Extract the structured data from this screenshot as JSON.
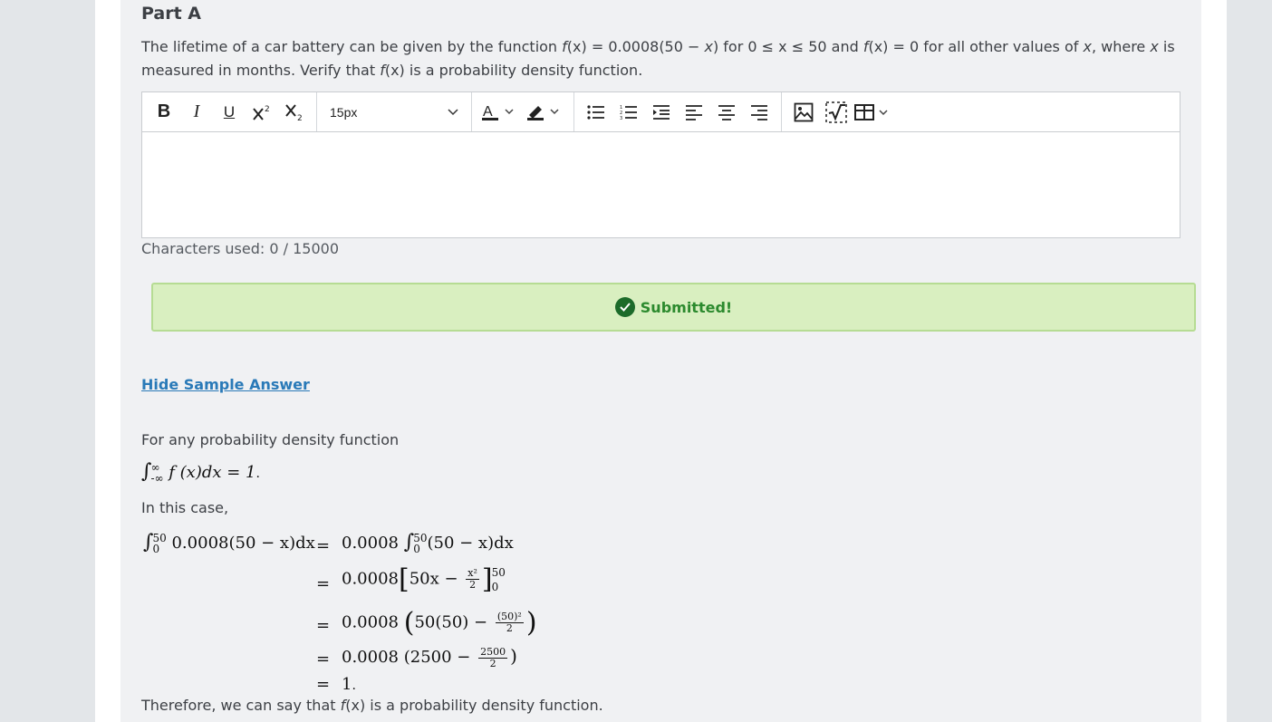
{
  "part_title": "Part A",
  "prompt": {
    "t1": "The lifetime of a car battery can be given by the function ",
    "f": "f",
    "x1": "(x)",
    "t2": " = 0.0008(50 − ",
    "x2": "x",
    "t3": ") for 0 ≤ x ≤ 50 and ",
    "f2": "f",
    "x3": "(x)",
    "t4": " = 0 for all other values of ",
    "x4": "x",
    "t5": ", where ",
    "x5": "x",
    "t6": " is measured in months. Verify that ",
    "f3": "f",
    "x6": "(x)",
    "t7": " is a probability density function."
  },
  "toolbar": {
    "bold": "B",
    "italic": "I",
    "underline": "U",
    "superscript_icon": "superscript-icon",
    "subscript_icon": "subscript-icon",
    "font_size": "15px",
    "font_color_icon": "font-color-icon",
    "highlight_icon": "highlight-icon",
    "bullet_list_icon": "bullet-list-icon",
    "numbered_list_icon": "numbered-list-icon",
    "indent_icon": "indent-icon",
    "align_left_icon": "align-left-icon",
    "align_center_icon": "align-center-icon",
    "align_right_icon": "align-right-icon",
    "image_icon": "image-icon",
    "equation_icon": "equation-icon",
    "table_icon": "table-icon"
  },
  "char_count": "Characters used: 0 / 15000",
  "status": {
    "label": "Submitted!",
    "color": "#2c8a2e",
    "bg": "#d9efc0"
  },
  "hide_link": "Hide Sample Answer",
  "answer": {
    "line1": "For any probability density function",
    "line2": "In this case,",
    "line3_pre": "Therefore, we can say that ",
    "line3_f": "f",
    "line3_x": "(x)",
    "line3_post": " is a probability density function."
  },
  "math": {
    "int_upper_inf": "∞",
    "int_lower_inf": "-∞",
    "pdf_body": "f (x)dx = 1",
    "pdf_end": ".",
    "upper": "50",
    "lower": "0",
    "row1_lhs": "0.0008(50 − x)dx",
    "eq": "=",
    "row1_rhs_pre": "0.0008",
    "row1_rhs_post": "(50 − x)dx",
    "row2_pre": "0.0008",
    "row2_body": "50x −",
    "row2_num": "x²",
    "row2_den": "2",
    "row3_pre": "0.0008",
    "row3_body": "50(50) −",
    "row3_num": "(50)²",
    "row3_den": "2",
    "row4_pre": "0.0008",
    "row4_body": "(2500 −",
    "row4_num": "2500",
    "row4_den": "2",
    "row4_close": ")",
    "row5": "1",
    "row5_end": "."
  }
}
